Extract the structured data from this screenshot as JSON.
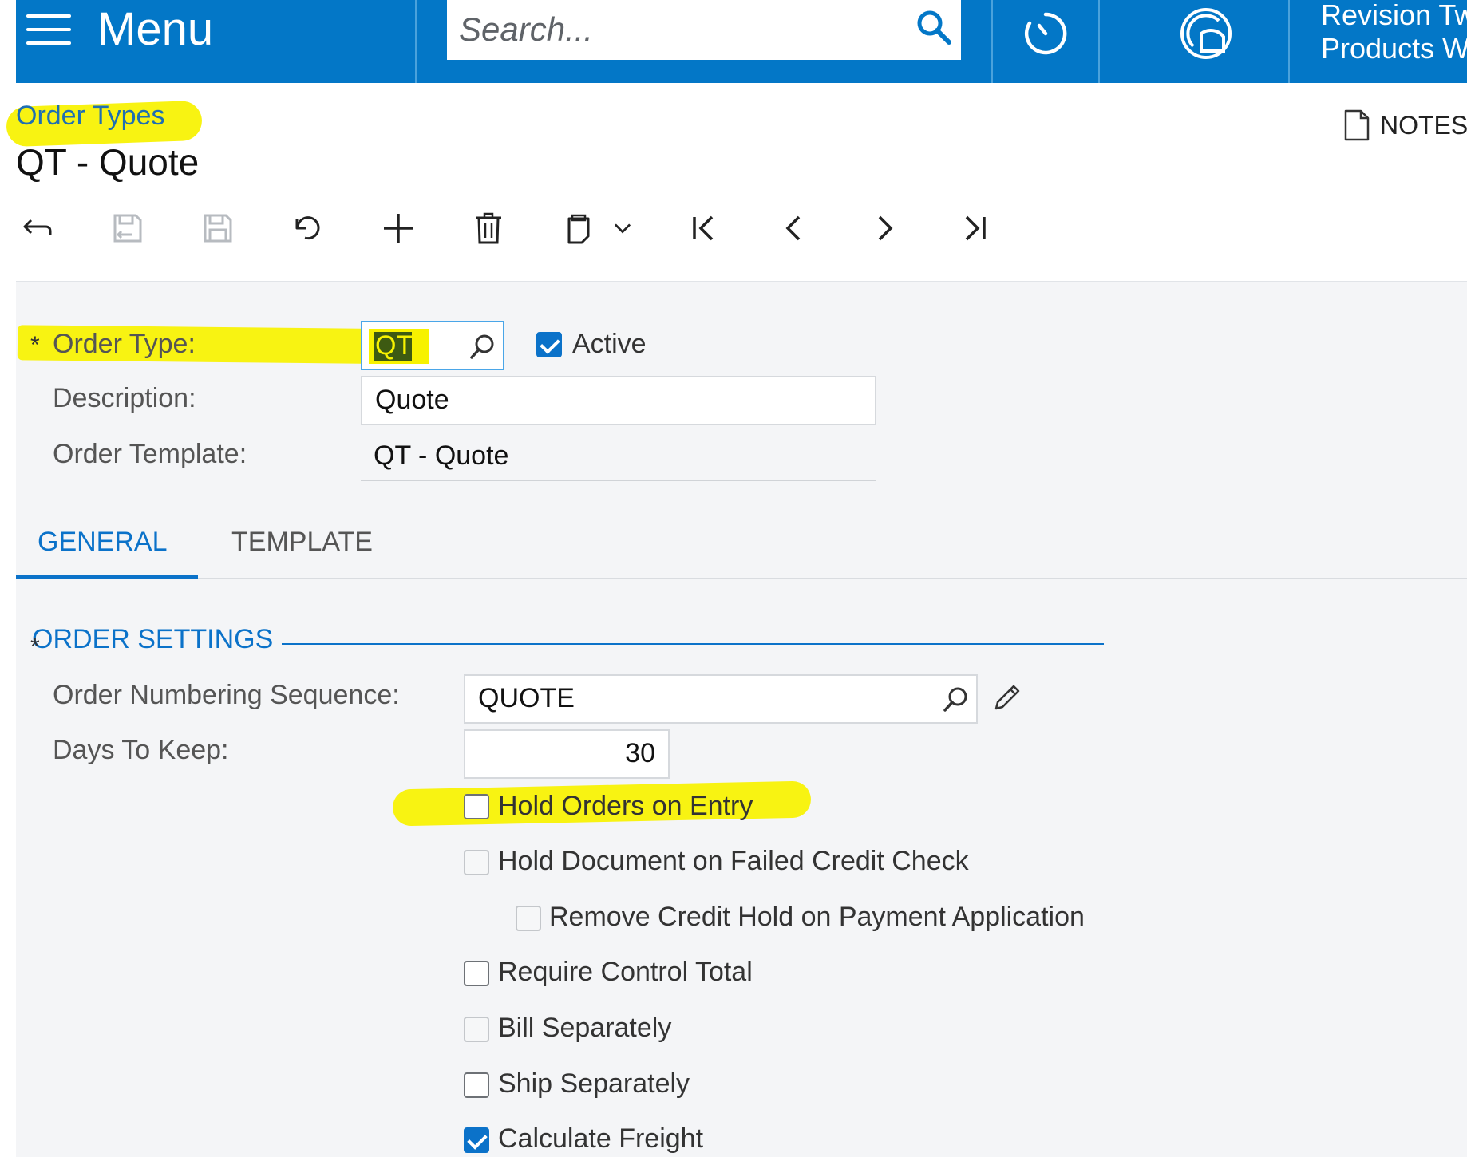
{
  "topbar": {
    "menu_label": "Menu",
    "search_placeholder": "Search...",
    "company_line1": "Revision Tw",
    "company_line2": "Products Wh",
    "icons": [
      "hamburger-icon",
      "search-icon",
      "clock-icon",
      "orbit-logo-icon"
    ],
    "background": "#0377c7"
  },
  "header": {
    "breadcrumb": "Order Types",
    "title": "QT - Quote",
    "notes_label": "NOTES"
  },
  "toolbar": {
    "buttons": [
      "back",
      "save-and-close",
      "save",
      "cancel",
      "add",
      "delete",
      "copy-paste",
      "first",
      "previous",
      "next",
      "last"
    ]
  },
  "form": {
    "order_type_label": "Order Type:",
    "order_type_value": "QT",
    "active_label": "Active",
    "active_checked": true,
    "description_label": "Description:",
    "description_value": "Quote",
    "template_label": "Order Template:",
    "template_value": "QT - Quote",
    "required_mark": "*"
  },
  "tabs": [
    {
      "label": "GENERAL",
      "active": true
    },
    {
      "label": "TEMPLATE",
      "active": false
    }
  ],
  "order_settings": {
    "title": "ORDER SETTINGS",
    "numbering_label": "Order Numbering Sequence:",
    "numbering_value": "QUOTE",
    "days_label": "Days To Keep:",
    "days_value": "30",
    "checkboxes": [
      {
        "label": "Hold Orders on Entry",
        "checked": false,
        "enabled": true
      },
      {
        "label": "Hold Document on Failed Credit Check",
        "checked": false,
        "enabled": false
      },
      {
        "label": "Remove Credit Hold on Payment Application",
        "checked": false,
        "enabled": false
      },
      {
        "label": "Require Control Total",
        "checked": false,
        "enabled": true
      },
      {
        "label": "Bill Separately",
        "checked": false,
        "enabled": false
      },
      {
        "label": "Ship Separately",
        "checked": false,
        "enabled": true
      },
      {
        "label": "Calculate Freight",
        "checked": true,
        "enabled": true
      }
    ]
  },
  "colors": {
    "accent": "#0b72c9",
    "highlight": "#f7f200",
    "content_background": "#f4f5f7"
  }
}
